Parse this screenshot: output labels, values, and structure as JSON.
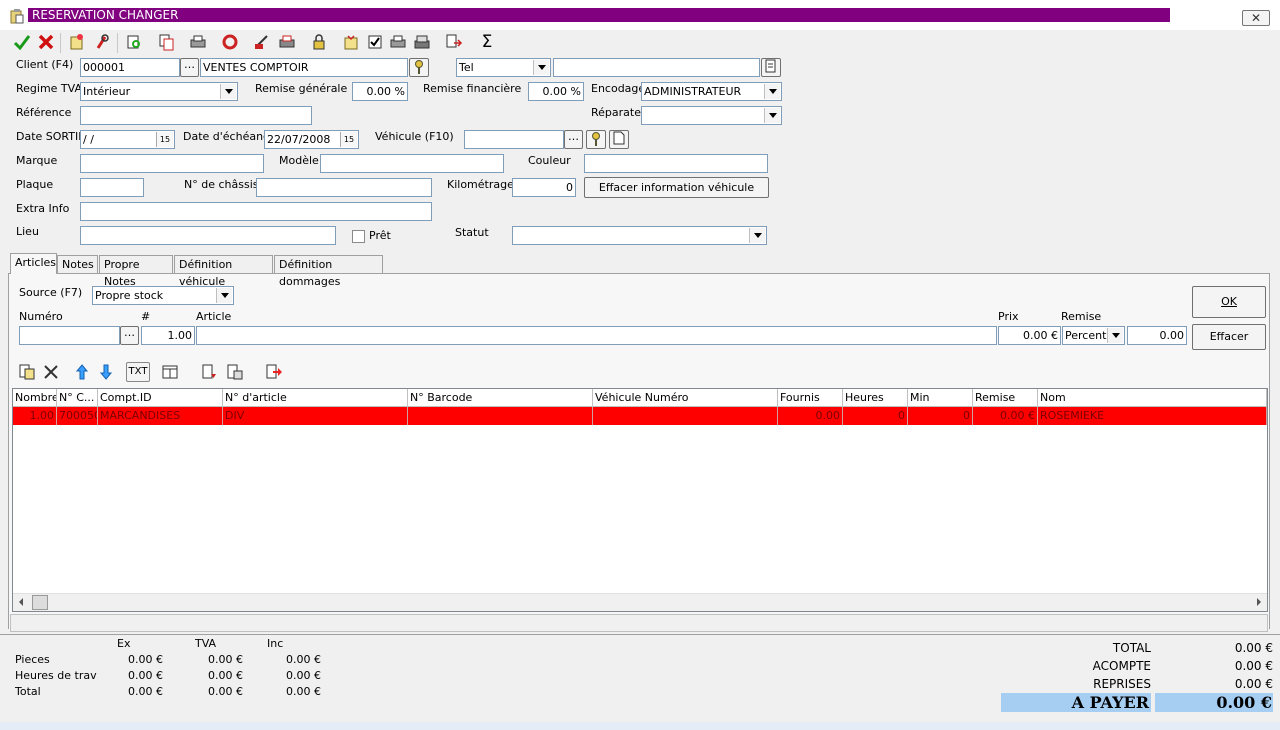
{
  "window": {
    "title": "RESERVATION CHANGER",
    "close_label": "✕"
  },
  "toolbar": {
    "sum_symbol": "Σ"
  },
  "form": {
    "client_label": "Client (F4)",
    "client_code": "000001",
    "client_name": "VENTES COMPTOIR",
    "phone_type": "Tel",
    "phone_value": "",
    "regime_label": "Regime TVA",
    "regime_value": "Intérieur",
    "remise_gen_label": "Remise générale",
    "remise_gen_value": "0.00 %",
    "remise_fin_label": "Remise financière",
    "remise_fin_value": "0.00 %",
    "encodage_label": "Encodage",
    "encodage_value": "ADMINISTRATEUR",
    "reference_label": "Référence",
    "reference_value": "",
    "reparateur_label": "Réparateu",
    "reparateur_value": "",
    "date_sortie_label": "Date SORTIE",
    "date_sortie_value": " / /",
    "date_echeance_label": "Date d'échéance",
    "date_echeance_value": "22/07/2008",
    "vehicule_label": "Véhicule (F10)",
    "vehicule_value": "",
    "marque_label": "Marque",
    "marque_value": "",
    "modele_label": "Modèle",
    "modele_value": "",
    "couleur_label": "Couleur",
    "couleur_value": "",
    "plaque_label": "Plaque",
    "plaque_value": "",
    "chassis_label": "N° de châssis",
    "chassis_value": "",
    "km_label": "Kilométrage",
    "km_value": "0",
    "effacer_vehicule_label": "Effacer information véhicule",
    "extra_label": "Extra Info",
    "extra_value": "",
    "lieu_label": "Lieu",
    "lieu_value": "",
    "pret_label": "Prêt",
    "statut_label": "Statut",
    "statut_value": ""
  },
  "tabs": [
    {
      "label": "Articles",
      "active": true
    },
    {
      "label": "Notes"
    },
    {
      "label": "Propre Notes"
    },
    {
      "label": "Définition véhicule"
    },
    {
      "label": "Définition dommages"
    }
  ],
  "articles": {
    "source_label": "Source (F7)",
    "source_value": "Propre stock",
    "numero_label": "Numéro",
    "qty_label": "#",
    "article_label": "Article",
    "prix_label": "Prix",
    "remise_label": "Remise",
    "numero_value": "",
    "qty_value": "1.00",
    "article_value": "",
    "prix_value": "0.00 €",
    "remise_type": "Percent",
    "remise_value": "0.00",
    "ok_label": "OK",
    "effacer_label": "Effacer",
    "txt_label": "TXT"
  },
  "grid": {
    "columns": [
      "Nombre",
      "N° C...",
      "Compt.ID",
      "N° d'article",
      "N° Barcode",
      "Véhicule Numéro",
      "Fournis",
      "Heures",
      "Min",
      "Remise",
      "Nom"
    ],
    "rows": [
      [
        "1.00",
        "700050",
        "MARCANDISES",
        "DIV",
        "",
        "",
        "0.00",
        "0",
        "0",
        "0.00 €",
        "ROSEMIEKE"
      ]
    ]
  },
  "summary": {
    "headers": [
      "Ex",
      "TVA",
      "Inc"
    ],
    "rows": [
      {
        "label": "Pieces",
        "values": [
          "0.00 €",
          "0.00 €",
          "0.00 €"
        ]
      },
      {
        "label": "Heures de trav",
        "values": [
          "0.00 €",
          "0.00 €",
          "0.00 €"
        ]
      },
      {
        "label": "Total",
        "values": [
          "0.00 €",
          "0.00 €",
          "0.00 €"
        ]
      }
    ]
  },
  "totals": {
    "total_label": "TOTAL",
    "total_value": "0.00 €",
    "acompte_label": "ACOMPTE",
    "acompte_value": "0.00 €",
    "reprises_label": "REPRISES",
    "reprises_value": "0.00 €",
    "apayer_label": "A PAYER",
    "apayer_value": "0.00 €"
  },
  "colors": {
    "title_bar": "#800080",
    "selected_row": "#ff0000",
    "apayer_bg": "#a6cdf2"
  }
}
